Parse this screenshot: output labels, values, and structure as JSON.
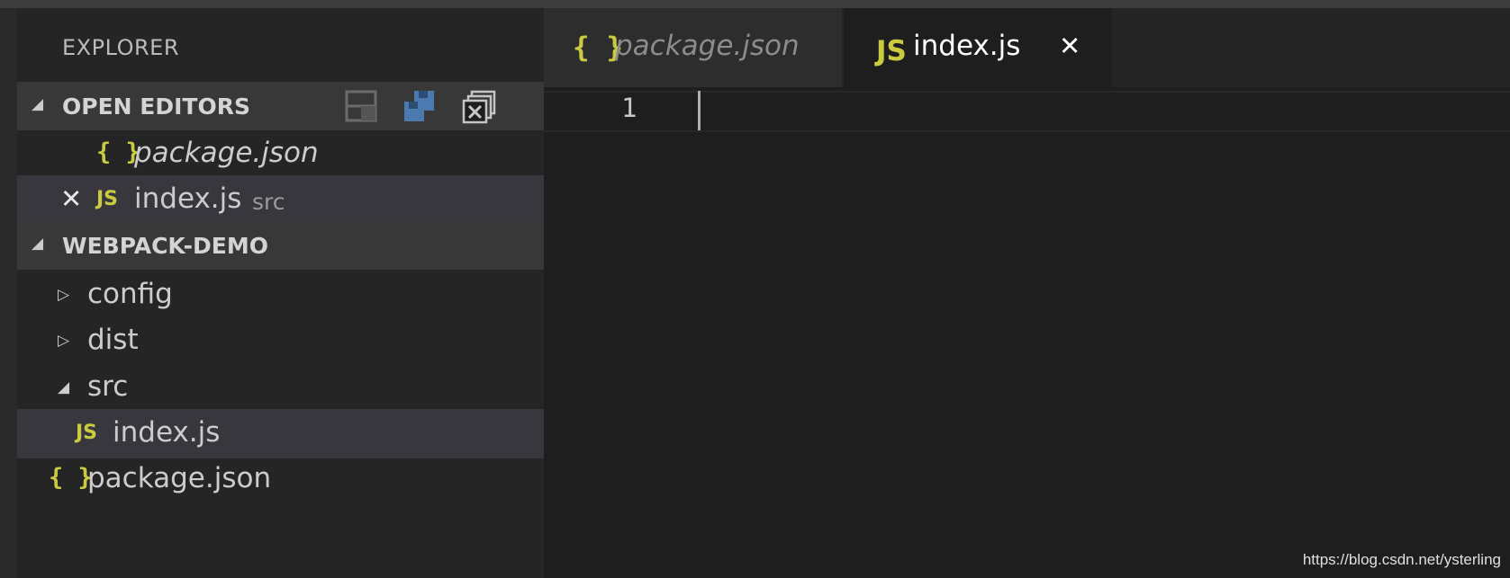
{
  "sidebar": {
    "title": "EXPLORER",
    "open_editors": {
      "label": "OPEN EDITORS",
      "items": [
        {
          "icon": "json-braces-icon",
          "glyph": "{ }",
          "name": "package.json",
          "path": ""
        },
        {
          "icon": "js-icon",
          "glyph": "JS",
          "name": "index.js",
          "path": "src",
          "close_glyph": "✕"
        }
      ]
    },
    "project": {
      "label": "WEBPACK-DEMO",
      "tree": [
        {
          "type": "folder",
          "name": "config",
          "twisty": "▷"
        },
        {
          "type": "folder",
          "name": "dist",
          "twisty": "▷"
        },
        {
          "type": "folder",
          "name": "src",
          "twisty": "◢"
        },
        {
          "type": "file",
          "glyph": "JS",
          "name": "index.js"
        },
        {
          "type": "file",
          "glyph": "{ }",
          "name": "package.json"
        }
      ]
    }
  },
  "editor": {
    "tabs": [
      {
        "glyph": "{ }",
        "label": "package.json",
        "active": false
      },
      {
        "glyph": "JS",
        "label": "index.js",
        "active": true,
        "close_glyph": "✕"
      }
    ],
    "line_numbers": [
      "1"
    ]
  },
  "watermark": "https://blog.csdn.net/ysterling",
  "colors": {
    "background": "#1e1e1e",
    "sidebar": "#252526",
    "section_header": "#383838",
    "selected_row": "#37373d",
    "file_icon_yellow": "#cbcb41",
    "save_icon_blue": "#4a7ab0"
  }
}
